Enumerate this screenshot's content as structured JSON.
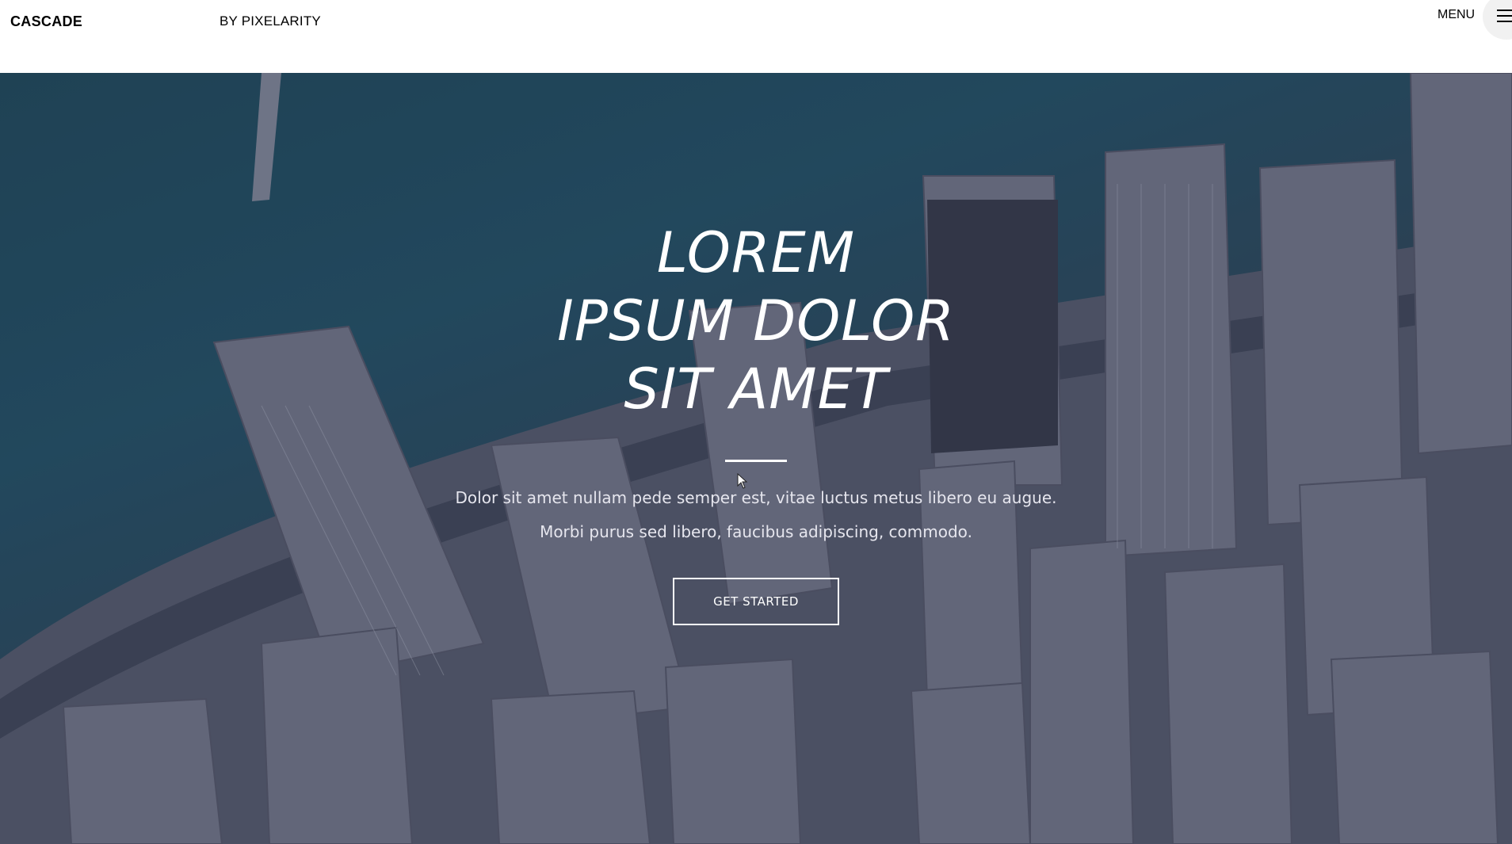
{
  "header": {
    "brand": "CASCADE",
    "byline": "BY PIXELARITY",
    "menu_label": "MENU",
    "menu_icon": "hamburger-icon"
  },
  "hero": {
    "title_lines": [
      "LOREM",
      "IPSUM DOLOR",
      "SIT AMET"
    ],
    "subtitle_lines": [
      "Dolor sit amet nullam pede semper est, vitae luctus metus libero eu augue.",
      "Morbi purus sed libero, faucibus adipiscing, commodo."
    ],
    "cta_label": "GET STARTED",
    "background": "aerial-city-skyline"
  },
  "colors": {
    "header_bg": "#ffffff",
    "hero_overlay": "#2b2d46",
    "water": "#23566a",
    "text_light": "#ffffff"
  }
}
